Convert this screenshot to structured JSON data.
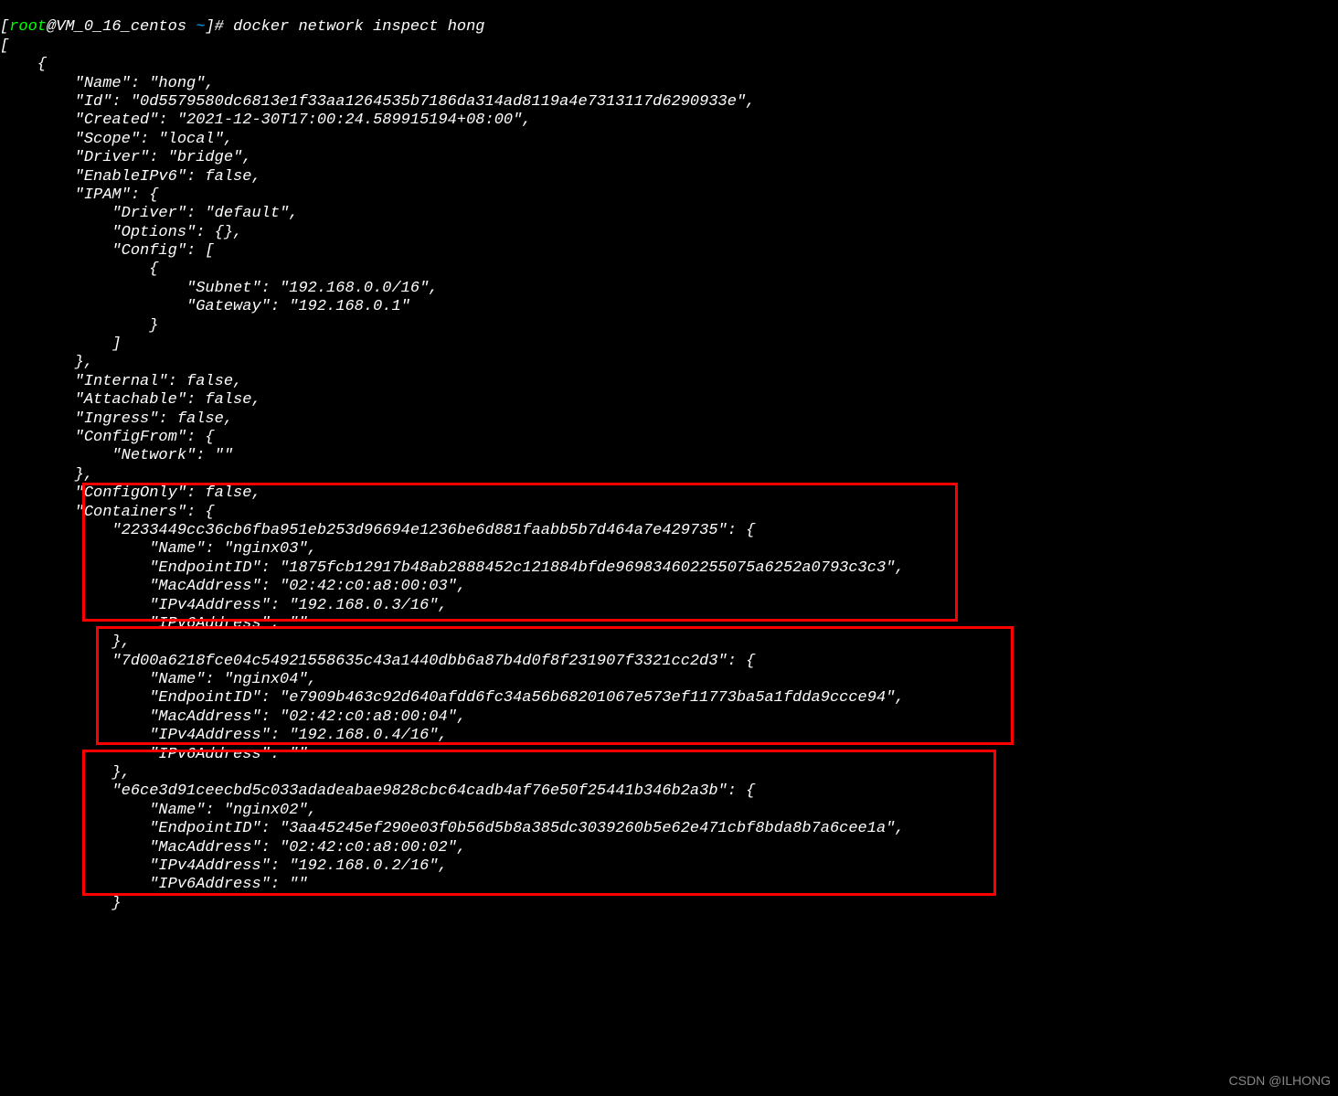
{
  "prompt": {
    "open_bracket": "[",
    "user": "root",
    "at": "@",
    "host": "VM_0_16_centos ",
    "tilde": "~",
    "close_bracket": "]",
    "hash": "# ",
    "command": "docker network inspect hong"
  },
  "line_open": "[",
  "obj_open": "    {",
  "name_line": "        \"Name\": \"hong\",",
  "id_line": "        \"Id\": \"0d5579580dc6813e1f33aa1264535b7186da314ad8119a4e7313117d6290933e\",",
  "created_line": "        \"Created\": \"2021-12-30T17:00:24.589915194+08:00\",",
  "scope_line": "        \"Scope\": \"local\",",
  "driver_line": "        \"Driver\": \"bridge\",",
  "enableipv6_line": "        \"EnableIPv6\": false,",
  "ipam_open": "        \"IPAM\": {",
  "ipam_driver": "            \"Driver\": \"default\",",
  "ipam_options": "            \"Options\": {},",
  "ipam_config_open": "            \"Config\": [",
  "ipam_cfg_brace": "                {",
  "ipam_subnet": "                    \"Subnet\": \"192.168.0.0/16\",",
  "ipam_gateway": "                    \"Gateway\": \"192.168.0.1\"",
  "ipam_cfg_close": "                }",
  "ipam_config_close": "            ]",
  "ipam_close": "        },",
  "internal_line": "        \"Internal\": false,",
  "attachable_line": "        \"Attachable\": false,",
  "ingress_line": "        \"Ingress\": false,",
  "configfrom_open": "        \"ConfigFrom\": {",
  "configfrom_net": "            \"Network\": \"\"",
  "configfrom_close": "        },",
  "configonly_line": "        \"ConfigOnly\": false,",
  "containers_open": "        \"Containers\": {",
  "c1_key": "            \"2233449cc36cb6fba951eb253d96694e1236be6d881faabb5b7d464a7e429735\": {",
  "c1_name": "                \"Name\": \"nginx03\",",
  "c1_eid": "                \"EndpointID\": \"1875fcb12917b48ab2888452c121884bfde969834602255075a6252a0793c3c3\",",
  "c1_mac": "                \"MacAddress\": \"02:42:c0:a8:00:03\",",
  "c1_ipv4": "                \"IPv4Address\": \"192.168.0.3/16\",",
  "c1_ipv6": "                \"IPv6Address\": \"\"",
  "c1_close": "            },",
  "c2_key": "            \"7d00a6218fce04c54921558635c43a1440dbb6a87b4d0f8f231907f3321cc2d3\": {",
  "c2_name": "                \"Name\": \"nginx04\",",
  "c2_eid": "                \"EndpointID\": \"e7909b463c92d640afdd6fc34a56b68201067e573ef11773ba5a1fdda9ccce94\",",
  "c2_mac": "                \"MacAddress\": \"02:42:c0:a8:00:04\",",
  "c2_ipv4": "                \"IPv4Address\": \"192.168.0.4/16\",",
  "c2_ipv6": "                \"IPv6Address\": \"\"",
  "c2_close": "            },",
  "c3_key": "            \"e6ce3d91ceecbd5c033adadeabae9828cbc64cadb4af76e50f25441b346b2a3b\": {",
  "c3_name": "                \"Name\": \"nginx02\",",
  "c3_eid": "                \"EndpointID\": \"3aa45245ef290e03f0b56d5b8a385dc3039260b5e62e471cbf8bda8b7a6cee1a\",",
  "c3_mac": "                \"MacAddress\": \"02:42:c0:a8:00:02\",",
  "c3_ipv4": "                \"IPv4Address\": \"192.168.0.2/16\",",
  "c3_ipv6": "                \"IPv6Address\": \"\"",
  "c3_close": "            }",
  "watermark": "CSDN @ILHONG"
}
